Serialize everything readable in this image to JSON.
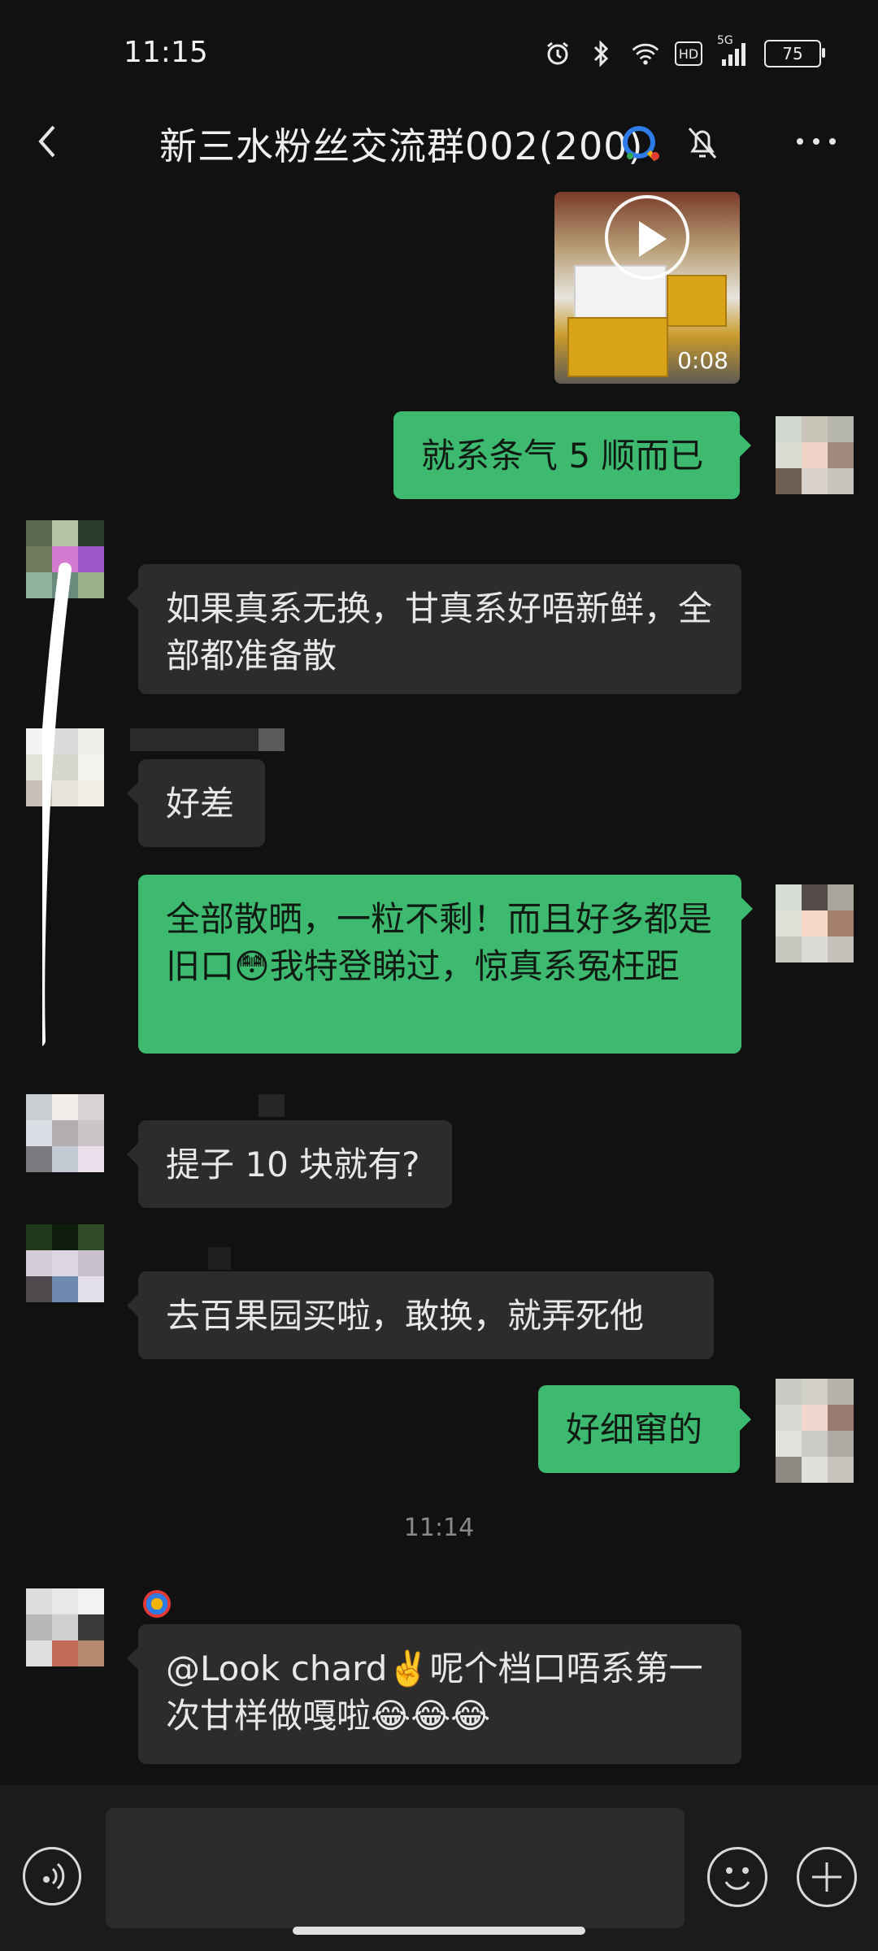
{
  "status_bar": {
    "time": "11:15",
    "battery": "75",
    "hd_label": "HD",
    "network_label": "5G"
  },
  "header": {
    "title": "新三水粉丝交流群002(200)"
  },
  "video_message": {
    "duration": "0:08"
  },
  "messages": [
    {
      "side": "out",
      "text": "就系条气 5 顺而已"
    },
    {
      "side": "in",
      "text": "如果真系无换，甘真系好唔新鲜，全部都准备散"
    },
    {
      "side": "in",
      "text": "好差"
    },
    {
      "side": "out",
      "text": "全部散晒，一粒不剩！而且好多都是旧口😳我特登睇过，惊真系冤枉距"
    },
    {
      "side": "in",
      "text": "提子 10 块就有?"
    },
    {
      "side": "in",
      "text": "去百果园买啦，敢换，就弄死他"
    },
    {
      "side": "out",
      "text": "好细窜的"
    },
    {
      "side": "in",
      "text": "@Look chard✌️呢个档口唔系第一次甘样做嘎啦😂😂😂"
    }
  ],
  "time_separator": "11:14",
  "colors": {
    "background": "#111111",
    "incoming_bubble": "#2c2c2c",
    "outgoing_bubble": "#3dba6f",
    "bottom_bar": "#1b1b1b"
  }
}
